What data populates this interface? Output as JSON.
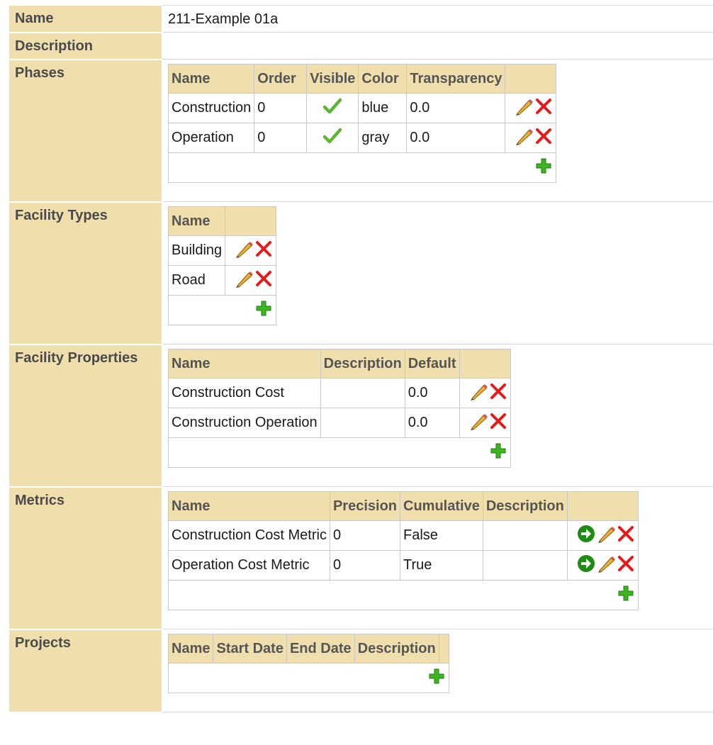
{
  "name": {
    "label": "Name",
    "value": "211-Example 01a"
  },
  "description": {
    "label": "Description",
    "value": ""
  },
  "phases": {
    "label": "Phases",
    "headers": [
      "Name",
      "Order",
      "Visible",
      "Color",
      "Transparency"
    ],
    "rows": [
      {
        "name": "Construction",
        "order": "0",
        "visible": true,
        "color": "blue",
        "transparency": "0.0"
      },
      {
        "name": "Operation",
        "order": "0",
        "visible": true,
        "color": "gray",
        "transparency": "0.0"
      }
    ]
  },
  "facility_types": {
    "label": "Facility Types",
    "headers": [
      "Name"
    ],
    "rows": [
      {
        "name": "Building"
      },
      {
        "name": "Road"
      }
    ]
  },
  "facility_properties": {
    "label": "Facility Properties",
    "headers": [
      "Name",
      "Description",
      "Default"
    ],
    "rows": [
      {
        "name": "Construction Cost",
        "description": "",
        "default": "0.0"
      },
      {
        "name": "Construction Operation",
        "description": "",
        "default": "0.0"
      }
    ]
  },
  "metrics": {
    "label": "Metrics",
    "headers": [
      "Name",
      "Precision",
      "Cumulative",
      "Description"
    ],
    "rows": [
      {
        "name": "Construction Cost Metric",
        "precision": "0",
        "cumulative": "False",
        "description": ""
      },
      {
        "name": "Operation Cost Metric",
        "precision": "0",
        "cumulative": "True",
        "description": ""
      }
    ]
  },
  "projects": {
    "label": "Projects",
    "headers": [
      "Name",
      "Start Date",
      "End Date",
      "Description"
    ]
  },
  "icons": {
    "edit": "pencil-icon",
    "delete": "delete-x-icon",
    "add": "add-plus-icon",
    "visible": "checkmark-icon",
    "go": "go-arrow-icon"
  },
  "colors": {
    "header_bg": "#f0dfac",
    "border": "#c8c8c8",
    "delete_red": "#e31b1b",
    "add_green": "#3cb521",
    "check_green": "#5fb336",
    "go_green": "#1e8c12"
  }
}
